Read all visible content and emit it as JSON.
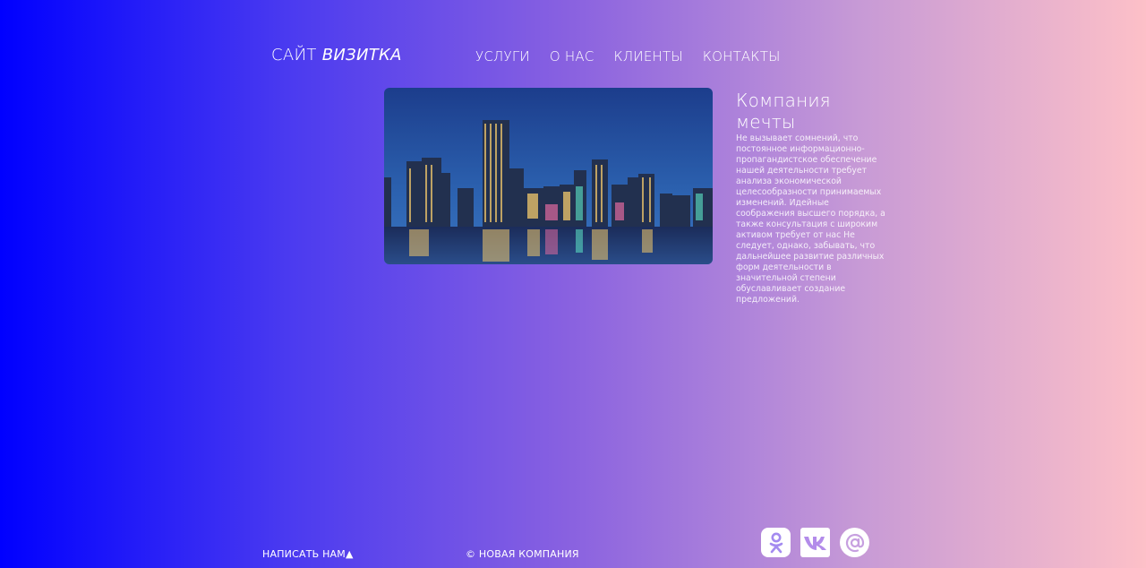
{
  "logo": {
    "part1": "САЙТ",
    "part2": "ВИЗИТКА"
  },
  "nav": {
    "items": [
      "УСЛУГИ",
      "О НАС",
      "КЛИЕНТЫ",
      "КОНТАКТЫ"
    ]
  },
  "hero": {
    "image": "city-skyline-night-image",
    "title": "Компания мечты",
    "text": "Не вызывает сомнений, что постоянное информационно-пропагандистское обеспечение нашей деятельности требует анализа экономической целесообразности принимаемых изменений. Идейные соображения высшего порядка, а также консультация с широким активом требует от нас Не следует, однако, забывать, что дальнейшее развитие различных форм деятельности в значительной степени обуславливает создание предложений."
  },
  "footer": {
    "write_us": "НАПИСАТЬ НАМ▲",
    "copyright": "© НОВАЯ КОМПАНИЯ",
    "socials": [
      {
        "icon": "odnoklassniki-icon"
      },
      {
        "icon": "vk-icon"
      },
      {
        "icon": "email-at-icon"
      }
    ]
  },
  "colors": {
    "gradient_start": "#0000ff",
    "gradient_end": "#fdc0c8",
    "text": "#ffffff"
  }
}
